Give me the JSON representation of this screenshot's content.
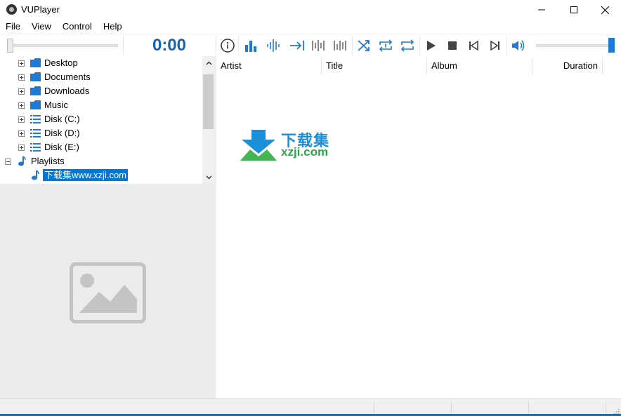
{
  "window": {
    "title": "VUPlayer"
  },
  "menu": [
    "File",
    "View",
    "Control",
    "Help"
  ],
  "toolbar": {
    "time": "0:00",
    "buttons": [
      "info-icon",
      "equalizer-icon",
      "waveform-icon",
      "crossfade-icon",
      "peak-meter-icon",
      "vu-meter-icon",
      "shuffle-icon",
      "repeat-track-icon",
      "repeat-playlist-icon",
      "play-icon",
      "stop-icon",
      "previous-icon",
      "next-icon",
      "volume-icon"
    ],
    "volume_level": 1.0,
    "seek_position": 0,
    "accent_color": "#1f7ad6"
  },
  "tree": {
    "items": [
      {
        "label": "Desktop",
        "icon": "folder-icon"
      },
      {
        "label": "Documents",
        "icon": "folder-icon"
      },
      {
        "label": "Downloads",
        "icon": "folder-icon"
      },
      {
        "label": "Music",
        "icon": "folder-icon"
      },
      {
        "label": "Disk (C:)",
        "icon": "disk-icon"
      },
      {
        "label": "Disk (D:)",
        "icon": "disk-icon"
      },
      {
        "label": "Disk (E:)",
        "icon": "disk-icon"
      },
      {
        "label": "Playlists",
        "icon": "music-note-icon"
      },
      {
        "label": "下载集www.xzji.com",
        "icon": "music-note-icon"
      }
    ]
  },
  "playlist": {
    "columns": [
      "Artist",
      "Title",
      "Album",
      "Duration"
    ]
  },
  "watermark": {
    "text": "下载集",
    "url": "xzji.com"
  }
}
